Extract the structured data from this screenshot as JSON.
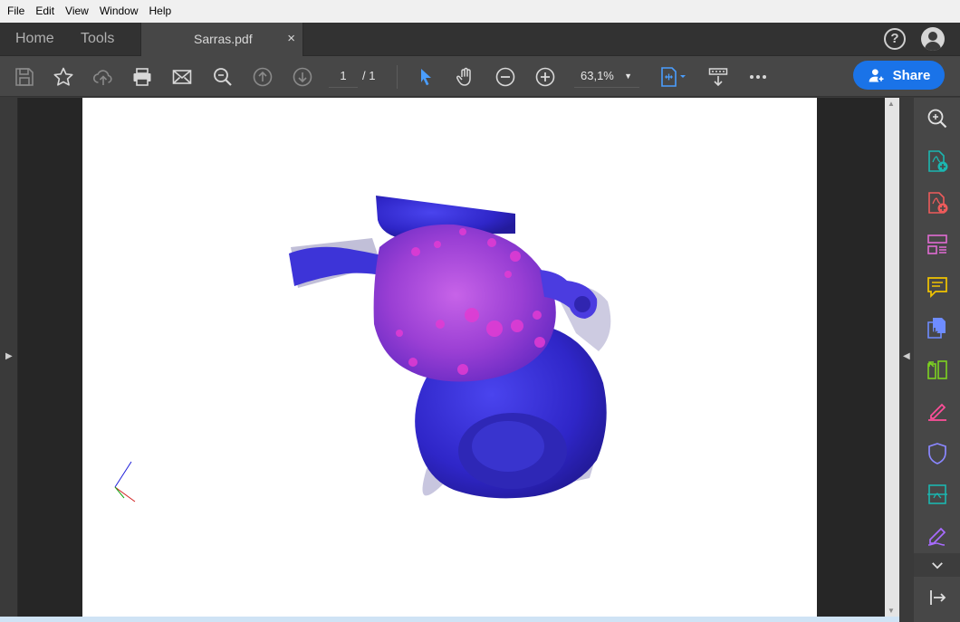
{
  "menu": [
    "File",
    "Edit",
    "View",
    "Window",
    "Help"
  ],
  "tabs": {
    "home": "Home",
    "tools": "Tools",
    "document": "Sarras.pdf",
    "close_symbol": "×"
  },
  "header_icons": {
    "help": "?"
  },
  "toolbar": {
    "page_current": "1",
    "page_total": "/ 1",
    "zoom": "63,1%",
    "share_label": "Share"
  },
  "colors": {
    "accent": "#1a73e8",
    "vessel_blue": "#3a2fd6",
    "vessel_magenta": "#b44be0"
  },
  "icons": {
    "toolbar": [
      "save-icon",
      "bookmark-star-icon",
      "upload-cloud-icon",
      "print-icon",
      "email-icon",
      "zoom-search-icon",
      "page-up-icon",
      "page-down-icon",
      "select-pointer-icon",
      "hand-icon",
      "zoom-out-icon",
      "zoom-in-icon",
      "fit-page-icon",
      "scroll-mode-icon",
      "more-icon"
    ],
    "tools_panel": [
      "search-zoom-icon",
      "create-pdf-icon",
      "export-pdf-icon",
      "organize-pages-icon",
      "comment-icon",
      "combine-files-icon",
      "compress-icon",
      "fill-sign-icon",
      "protect-icon",
      "scan-ocr-icon",
      "edit-pen-icon",
      "expand-more-icon",
      "exit-panel-icon"
    ]
  }
}
